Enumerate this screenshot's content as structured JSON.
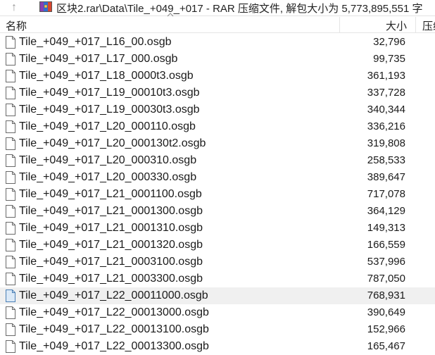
{
  "window": {
    "path": "区块2.rar\\Data\\Tile_+049_+017 - RAR 压缩文件, 解包大小为 5,773,895,551 字"
  },
  "toolbar": {
    "up_glyph": "↑"
  },
  "columns": {
    "name": "名称",
    "size": "大小",
    "packed": "压缩"
  },
  "files": [
    {
      "name": "Tile_+049_+017_L16_00.osgb",
      "size": "32,796"
    },
    {
      "name": "Tile_+049_+017_L17_000.osgb",
      "size": "99,735"
    },
    {
      "name": "Tile_+049_+017_L18_0000t3.osgb",
      "size": "361,193"
    },
    {
      "name": "Tile_+049_+017_L19_00010t3.osgb",
      "size": "337,728"
    },
    {
      "name": "Tile_+049_+017_L19_00030t3.osgb",
      "size": "340,344"
    },
    {
      "name": "Tile_+049_+017_L20_000110.osgb",
      "size": "336,216"
    },
    {
      "name": "Tile_+049_+017_L20_000130t2.osgb",
      "size": "319,808"
    },
    {
      "name": "Tile_+049_+017_L20_000310.osgb",
      "size": "258,533"
    },
    {
      "name": "Tile_+049_+017_L20_000330.osgb",
      "size": "389,647"
    },
    {
      "name": "Tile_+049_+017_L21_0001100.osgb",
      "size": "717,078"
    },
    {
      "name": "Tile_+049_+017_L21_0001300.osgb",
      "size": "364,129"
    },
    {
      "name": "Tile_+049_+017_L21_0001310.osgb",
      "size": "149,313"
    },
    {
      "name": "Tile_+049_+017_L21_0001320.osgb",
      "size": "166,559"
    },
    {
      "name": "Tile_+049_+017_L21_0003100.osgb",
      "size": "537,996"
    },
    {
      "name": "Tile_+049_+017_L21_0003300.osgb",
      "size": "787,050"
    },
    {
      "name": "Tile_+049_+017_L22_00011000.osgb",
      "size": "768,931"
    },
    {
      "name": "Tile_+049_+017_L22_00013000.osgb",
      "size": "390,649"
    },
    {
      "name": "Tile_+049_+017_L22_00013100.osgb",
      "size": "152,966"
    },
    {
      "name": "Tile_+049_+017_L22_00013300.osgb",
      "size": "165,467"
    }
  ],
  "selected_index": 15,
  "colors": {
    "selection": "#f0f0f0",
    "archive_icon": "#7a3fa0"
  }
}
